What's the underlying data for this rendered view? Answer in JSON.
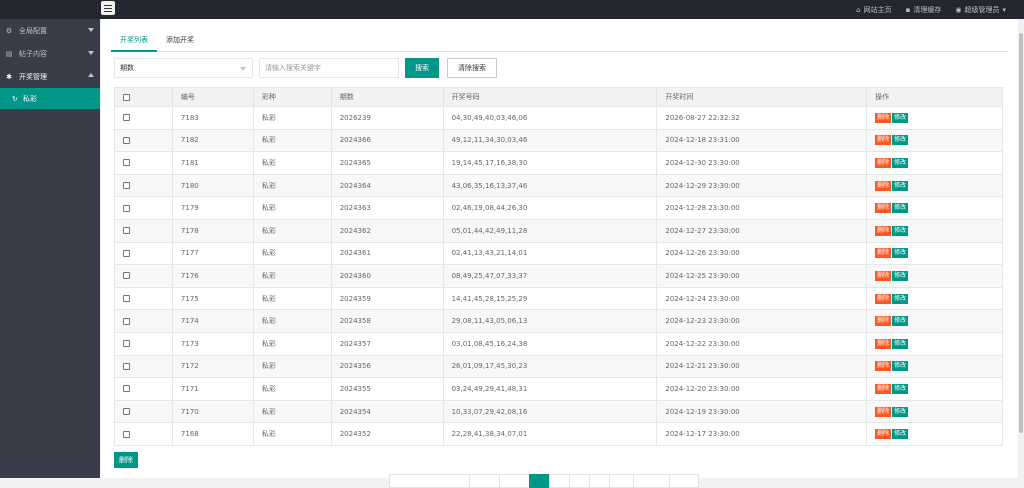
{
  "topnav": {
    "site_home": "网站主页",
    "clear_cache": "清理缓存",
    "user": "超级管理员"
  },
  "sidebar": {
    "items": [
      {
        "label": "全局配置",
        "icon": "gear-icon"
      },
      {
        "label": "帖子内容",
        "icon": "document-icon"
      },
      {
        "label": "开奖管理",
        "icon": "settings-icon"
      }
    ],
    "sub_active": {
      "label": "私彩",
      "icon": "refresh-icon"
    }
  },
  "tabs": [
    {
      "label": "开奖列表",
      "active": true
    },
    {
      "label": "添加开奖",
      "active": false
    }
  ],
  "filter": {
    "select_value": "期数",
    "search_placeholder": "请输入搜索关键字",
    "search_button": "搜索",
    "clear_button": "清除搜索"
  },
  "table": {
    "headers": [
      "编号",
      "彩种",
      "期数",
      "开奖号码",
      "开奖时间",
      "操作"
    ],
    "delete_label": "删除",
    "edit_label": "修改",
    "rows": [
      [
        "7183",
        "私彩",
        "2026239",
        "04,30,49,40,03,46,06",
        "2026-08-27 22:32:32"
      ],
      [
        "7182",
        "私彩",
        "2024366",
        "49,12,11,34,30,03,46",
        "2024-12-18 23:31:00"
      ],
      [
        "7181",
        "私彩",
        "2024365",
        "19,14,45,17,16,38,30",
        "2024-12-30 23:30:00"
      ],
      [
        "7180",
        "私彩",
        "2024364",
        "43,06,35,16,13,37,46",
        "2024-12-29 23:30:00"
      ],
      [
        "7179",
        "私彩",
        "2024363",
        "02,46,19,08,44,26,30",
        "2024-12-28 23:30:00"
      ],
      [
        "7178",
        "私彩",
        "2024362",
        "05,01,44,42,49,11,28",
        "2024-12-27 23:30:00"
      ],
      [
        "7177",
        "私彩",
        "2024361",
        "02,41,13,43,21,14,01",
        "2024-12-26 23:30:00"
      ],
      [
        "7176",
        "私彩",
        "2024360",
        "08,49,25,47,07,33,37",
        "2024-12-25 23:30:00"
      ],
      [
        "7175",
        "私彩",
        "2024359",
        "14,41,45,28,15,25,29",
        "2024-12-24 23:30:00"
      ],
      [
        "7174",
        "私彩",
        "2024358",
        "29,08,11,43,05,06,13",
        "2024-12-23 23:30:00"
      ],
      [
        "7173",
        "私彩",
        "2024357",
        "03,01,08,45,16,24,38",
        "2024-12-22 23:30:00"
      ],
      [
        "7172",
        "私彩",
        "2024356",
        "26,01,09,17,45,30,23",
        "2024-12-21 23:30:00"
      ],
      [
        "7171",
        "私彩",
        "2024355",
        "03,24,49,29,41,48,31",
        "2024-12-20 23:30:00"
      ],
      [
        "7170",
        "私彩",
        "2024354",
        "10,33,07,29,42,08,16",
        "2024-12-19 23:30:00"
      ],
      [
        "7168",
        "私彩",
        "2024352",
        "22,28,41,38,34,07,01",
        "2024-12-17 23:30:00"
      ]
    ]
  },
  "bulk_delete": "删除",
  "colors": {
    "accent": "#009688",
    "danger": "#ff5722",
    "sidebar_bg": "#393d49",
    "topbar_bg": "#23262e"
  }
}
